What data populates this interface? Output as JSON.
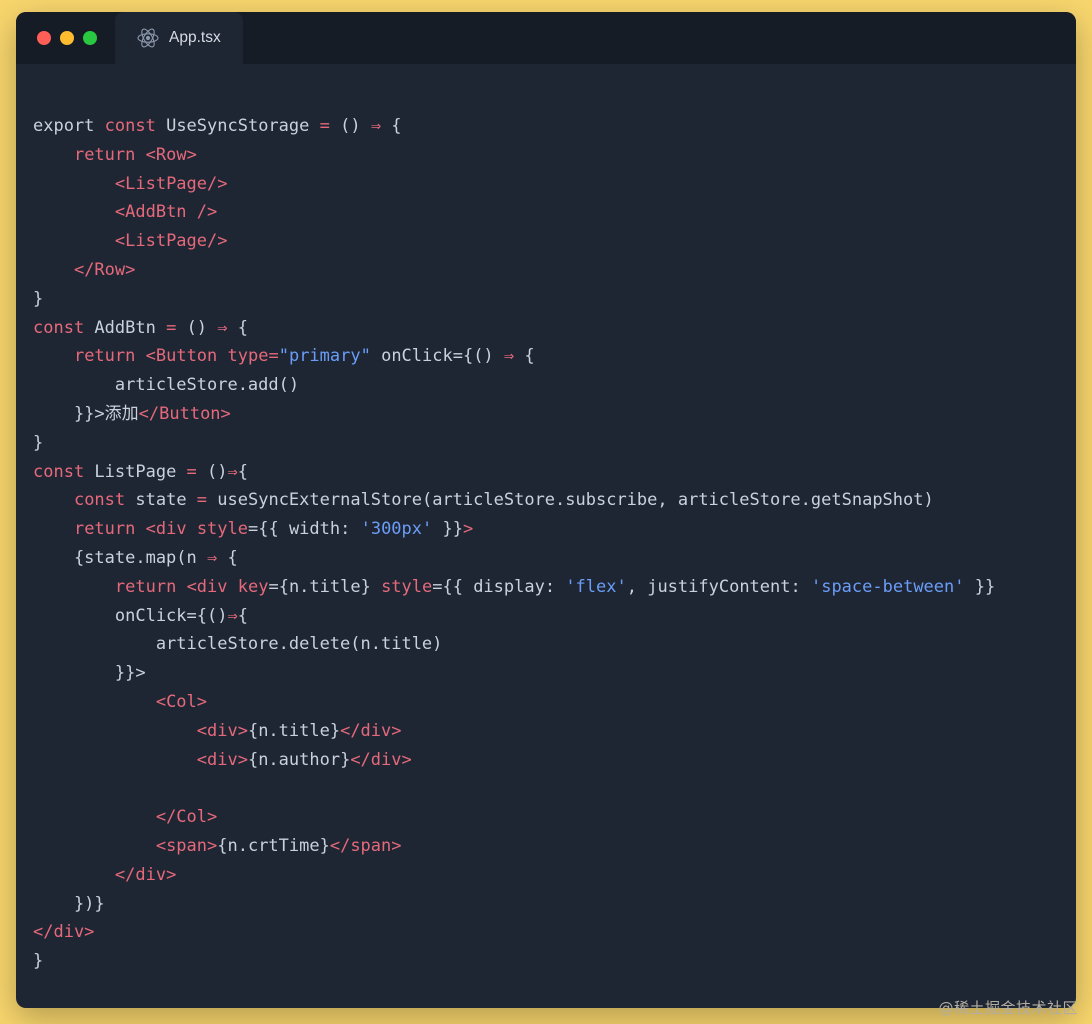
{
  "page": {
    "watermark": "@稀土掘金技术社区"
  },
  "window": {
    "tab_label": "App.tsx",
    "tab_icon": "react-icon",
    "traffic_lights": [
      {
        "name": "close-button",
        "color": "#ff5f57"
      },
      {
        "name": "minimize-button",
        "color": "#febc2e"
      },
      {
        "name": "maximize-button",
        "color": "#2ac840"
      }
    ]
  },
  "colors": {
    "page-bg": "#f8d66d",
    "window-bg": "#1f2633",
    "titlebar-bg": "#161c26",
    "tab-bg": "#1f2633",
    "tab-text": "#d7dce4",
    "kw": "#e5697b",
    "str": "#6a9df8",
    "pl": "#c9d1dc",
    "react-icon": "#8b98ab",
    "watermark": "#b3aea2"
  },
  "code": {
    "lines": [
      [
        {
          "t": "export ",
          "c": "pl"
        },
        {
          "t": "const",
          "c": "kw"
        },
        {
          "t": " UseSyncStorage ",
          "c": "pl"
        },
        {
          "t": "=",
          "c": "kw"
        },
        {
          "t": " () ",
          "c": "pl"
        },
        {
          "t": "⇒",
          "c": "kw"
        },
        {
          "t": " {",
          "c": "pl"
        }
      ],
      [
        {
          "t": "    ",
          "c": "pl"
        },
        {
          "t": "return",
          "c": "kw"
        },
        {
          "t": " ",
          "c": "pl"
        },
        {
          "t": "<Row>",
          "c": "kw"
        }
      ],
      [
        {
          "t": "        ",
          "c": "pl"
        },
        {
          "t": "<ListPage/>",
          "c": "kw"
        }
      ],
      [
        {
          "t": "        ",
          "c": "pl"
        },
        {
          "t": "<AddBtn />",
          "c": "kw"
        }
      ],
      [
        {
          "t": "        ",
          "c": "pl"
        },
        {
          "t": "<ListPage/>",
          "c": "kw"
        }
      ],
      [
        {
          "t": "    ",
          "c": "pl"
        },
        {
          "t": "</Row>",
          "c": "kw"
        }
      ],
      [
        {
          "t": "}",
          "c": "pl"
        }
      ],
      [
        {
          "t": "const",
          "c": "kw"
        },
        {
          "t": " AddBtn ",
          "c": "pl"
        },
        {
          "t": "=",
          "c": "kw"
        },
        {
          "t": " () ",
          "c": "pl"
        },
        {
          "t": "⇒",
          "c": "kw"
        },
        {
          "t": " {",
          "c": "pl"
        }
      ],
      [
        {
          "t": "    ",
          "c": "pl"
        },
        {
          "t": "return",
          "c": "kw"
        },
        {
          "t": " ",
          "c": "pl"
        },
        {
          "t": "<Button ",
          "c": "kw"
        },
        {
          "t": "type",
          "c": "kw"
        },
        {
          "t": "=",
          "c": "kw"
        },
        {
          "t": "\"primary\"",
          "c": "str"
        },
        {
          "t": " onClick={() ",
          "c": "pl"
        },
        {
          "t": "⇒",
          "c": "kw"
        },
        {
          "t": " {",
          "c": "pl"
        }
      ],
      [
        {
          "t": "        articleStore.add()",
          "c": "pl"
        }
      ],
      [
        {
          "t": "    }}>",
          "c": "pl"
        },
        {
          "t": "添加",
          "c": "pl"
        },
        {
          "t": "</Button>",
          "c": "kw"
        }
      ],
      [
        {
          "t": "}",
          "c": "pl"
        }
      ],
      [
        {
          "t": "const",
          "c": "kw"
        },
        {
          "t": " ListPage ",
          "c": "pl"
        },
        {
          "t": "=",
          "c": "kw"
        },
        {
          "t": " ()",
          "c": "pl"
        },
        {
          "t": "⇒",
          "c": "kw"
        },
        {
          "t": "{",
          "c": "pl"
        }
      ],
      [
        {
          "t": "    ",
          "c": "pl"
        },
        {
          "t": "const",
          "c": "kw"
        },
        {
          "t": " state ",
          "c": "pl"
        },
        {
          "t": "=",
          "c": "kw"
        },
        {
          "t": " useSyncExternalStore(articleStore.subscribe, articleStore.getSnapShot)",
          "c": "pl"
        }
      ],
      [
        {
          "t": "    ",
          "c": "pl"
        },
        {
          "t": "return",
          "c": "kw"
        },
        {
          "t": " ",
          "c": "pl"
        },
        {
          "t": "<div ",
          "c": "kw"
        },
        {
          "t": "style",
          "c": "kw"
        },
        {
          "t": "={{ width: ",
          "c": "pl"
        },
        {
          "t": "'300px'",
          "c": "str"
        },
        {
          "t": " }}",
          "c": "pl"
        },
        {
          "t": ">",
          "c": "kw"
        }
      ],
      [
        {
          "t": "    {state.map(n ",
          "c": "pl"
        },
        {
          "t": "⇒",
          "c": "kw"
        },
        {
          "t": " {",
          "c": "pl"
        }
      ],
      [
        {
          "t": "        ",
          "c": "pl"
        },
        {
          "t": "return",
          "c": "kw"
        },
        {
          "t": " ",
          "c": "pl"
        },
        {
          "t": "<div ",
          "c": "kw"
        },
        {
          "t": "key",
          "c": "kw"
        },
        {
          "t": "={n.title} ",
          "c": "pl"
        },
        {
          "t": "style",
          "c": "kw"
        },
        {
          "t": "={{ display: ",
          "c": "pl"
        },
        {
          "t": "'flex'",
          "c": "str"
        },
        {
          "t": ", justifyContent: ",
          "c": "pl"
        },
        {
          "t": "'space-between'",
          "c": "str"
        },
        {
          "t": " }}",
          "c": "pl"
        }
      ],
      [
        {
          "t": "        onClick={()",
          "c": "pl"
        },
        {
          "t": "⇒",
          "c": "kw"
        },
        {
          "t": "{",
          "c": "pl"
        }
      ],
      [
        {
          "t": "            articleStore.delete(n.title)",
          "c": "pl"
        }
      ],
      [
        {
          "t": "        }}>",
          "c": "pl"
        }
      ],
      [
        {
          "t": "            ",
          "c": "pl"
        },
        {
          "t": "<Col>",
          "c": "kw"
        }
      ],
      [
        {
          "t": "                ",
          "c": "pl"
        },
        {
          "t": "<div>",
          "c": "kw"
        },
        {
          "t": "{n.title}",
          "c": "pl"
        },
        {
          "t": "</div>",
          "c": "kw"
        }
      ],
      [
        {
          "t": "                ",
          "c": "pl"
        },
        {
          "t": "<div>",
          "c": "kw"
        },
        {
          "t": "{n.author}",
          "c": "pl"
        },
        {
          "t": "</div>",
          "c": "kw"
        }
      ],
      [],
      [
        {
          "t": "            ",
          "c": "pl"
        },
        {
          "t": "</Col>",
          "c": "kw"
        }
      ],
      [
        {
          "t": "            ",
          "c": "pl"
        },
        {
          "t": "<span>",
          "c": "kw"
        },
        {
          "t": "{n.crtTime}",
          "c": "pl"
        },
        {
          "t": "</span>",
          "c": "kw"
        }
      ],
      [
        {
          "t": "        ",
          "c": "pl"
        },
        {
          "t": "</div>",
          "c": "kw"
        }
      ],
      [
        {
          "t": "    })}",
          "c": "pl"
        }
      ],
      [
        {
          "t": "</div>",
          "c": "kw"
        }
      ],
      [
        {
          "t": "}",
          "c": "pl"
        }
      ]
    ]
  }
}
